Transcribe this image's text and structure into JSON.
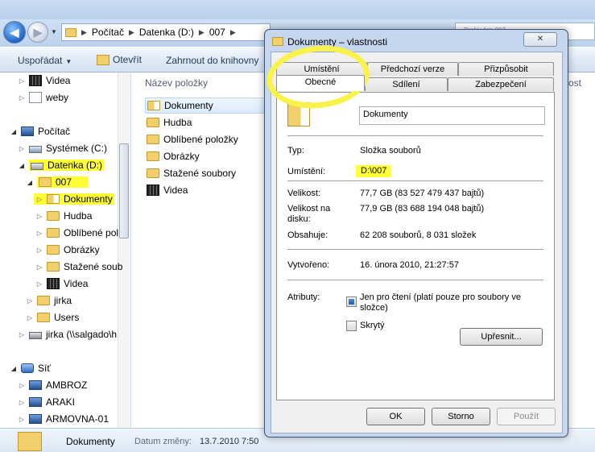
{
  "explorer": {
    "address_crumbs": [
      "Počítač",
      "Datenka (D:)",
      "007"
    ],
    "search_placeholder": "Prohledat: 007",
    "toolbar": {
      "organize": "Uspořádat",
      "open": "Otevřít",
      "library": "Zahrnout do knihovny"
    },
    "nav_tree": [
      {
        "label": "Videa",
        "icon": "video-icon"
      },
      {
        "label": "weby",
        "icon": "web-folder-icon"
      },
      {
        "label": "Počítač",
        "icon": "computer-icon"
      },
      {
        "label": "Systémek (C:)",
        "icon": "system-drive-icon"
      },
      {
        "label": "Datenka (D:)",
        "icon": "drive-icon",
        "highlighted": true
      },
      {
        "label": "007",
        "icon": "folder-icon",
        "highlighted": true
      },
      {
        "label": "Dokumenty",
        "icon": "documents-icon",
        "highlighted": true
      },
      {
        "label": "Hudba",
        "icon": "music-folder-icon"
      },
      {
        "label": "Oblíbené pol",
        "icon": "favorites-folder-icon"
      },
      {
        "label": "Obrázky",
        "icon": "pictures-folder-icon"
      },
      {
        "label": "Stažené soub",
        "icon": "downloads-folder-icon"
      },
      {
        "label": "Videa",
        "icon": "video-icon"
      },
      {
        "label": "jirka",
        "icon": "folder-icon"
      },
      {
        "label": "Users",
        "icon": "folder-icon"
      },
      {
        "label": "jirka (\\\\salgado\\h",
        "icon": "network-drive-icon"
      },
      {
        "label": "Síť",
        "icon": "network-icon"
      },
      {
        "label": "AMBROZ",
        "icon": "network-computer-icon"
      },
      {
        "label": "ARAKI",
        "icon": "network-computer-icon"
      },
      {
        "label": "ARMOVNA-01",
        "icon": "network-computer-icon"
      }
    ],
    "column_name": "Název položky",
    "column_right": "ost",
    "files": [
      "Dokumenty",
      "Hudba",
      "Oblíbené položky",
      "Obrázky",
      "Stažené soubory",
      "Videa"
    ],
    "details": {
      "name": "Dokumenty",
      "date_label": "Datum změny:",
      "date_value": "13.7.2010 7:50"
    },
    "highlight_color": "#ffff33"
  },
  "dialog": {
    "title": "Dokumenty – vlastnosti",
    "close_label": "✕",
    "tabs_row1": [
      "Umístění",
      "Předchozí verze",
      "Přizpůsobit"
    ],
    "tabs_row2": [
      "Obecné",
      "Sdílení",
      "Zabezpečení"
    ],
    "folder_name": "Dokumenty",
    "props": {
      "type_label": "Typ:",
      "type_value": "Složka souborů",
      "location_label": "Umístění:",
      "location_value": "D:\\007",
      "size_label": "Velikost:",
      "size_value": "77,7 GB (83 527 479 437 bajtů)",
      "disk_size_label": "Velikost na disku:",
      "disk_size_value": "77,9 GB (83 688 194 048 bajtů)",
      "contains_label": "Obsahuje:",
      "contains_value": "62 208 souborů, 8 031 složek",
      "created_label": "Vytvořeno:",
      "created_value": "16. února 2010, 21:27:57",
      "attributes_label": "Atributy:",
      "readonly_label": "Jen pro čtení (platí pouze pro soubory ve složce)",
      "hidden_label": "Skrytý",
      "advanced_button": "Upřesnit..."
    },
    "buttons": {
      "ok": "OK",
      "cancel": "Storno",
      "apply": "Použít"
    }
  }
}
